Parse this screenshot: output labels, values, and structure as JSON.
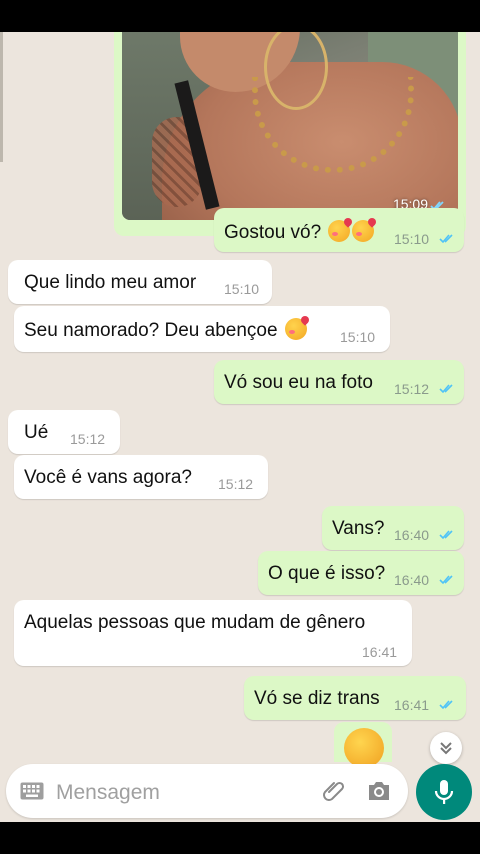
{
  "conversation": {
    "image_message": {
      "time": "15:09",
      "status": "read"
    },
    "messages": [
      {
        "dir": "out",
        "text": "Gostou vó?",
        "emoji": "smiling-face-with-hearts x2",
        "time": "15:10",
        "status": "read"
      },
      {
        "dir": "in",
        "text": "Que lindo meu amor",
        "time": "15:10"
      },
      {
        "dir": "in",
        "text": "Seu namorado? Deu abençoe",
        "emoji": "smiling-face-with-hearts",
        "time": "15:10"
      },
      {
        "dir": "out",
        "text": "Vó sou eu na foto",
        "time": "15:12",
        "status": "read"
      },
      {
        "dir": "in",
        "text": "Ué",
        "time": "15:12"
      },
      {
        "dir": "in",
        "text": "Você é vans agora?",
        "time": "15:12"
      },
      {
        "dir": "out",
        "text": "Vans?",
        "time": "16:40",
        "status": "read"
      },
      {
        "dir": "out",
        "text": "O que é isso?",
        "time": "16:40",
        "status": "read"
      },
      {
        "dir": "in",
        "text": "Aquelas pessoas que mudam de gênero",
        "time": "16:41"
      },
      {
        "dir": "out",
        "text": "Vó se diz trans",
        "time": "16:41",
        "status": "read"
      },
      {
        "dir": "out",
        "emoji": "rolling-on-the-floor-laughing",
        "partial": true
      }
    ]
  },
  "composer": {
    "placeholder": "Mensagem",
    "icons": [
      "keyboard-icon",
      "attach-icon",
      "camera-icon",
      "mic-icon"
    ]
  },
  "scroll_down_icon": "chevron-double-down-icon",
  "colors": {
    "chat_bg": "#ece5dd",
    "outgoing_bubble": "#dcf8c6",
    "incoming_bubble": "#ffffff",
    "read_ticks": "#4fc3f7",
    "accent": "#00897b"
  }
}
